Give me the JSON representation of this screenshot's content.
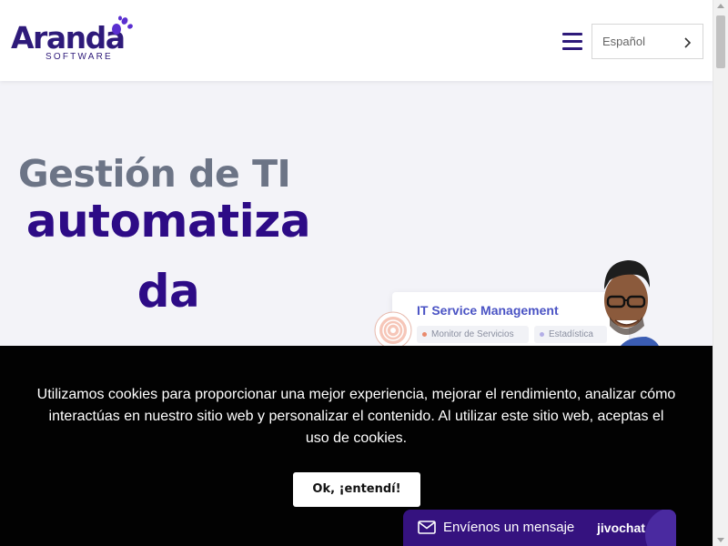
{
  "header": {
    "logo": {
      "name": "Aranda",
      "sub": "SOFTWARE"
    },
    "menu_icon": "hamburger-menu-icon",
    "language": {
      "label": "Español",
      "icon": "chevron-right-icon"
    }
  },
  "hero": {
    "title": "Gestión de TI",
    "accent_line1": "automatiza",
    "accent_line2": "da"
  },
  "itsm_card": {
    "title": "IT Service Management",
    "chips": [
      "Monitor de Servicios",
      "Estadística"
    ]
  },
  "cookie": {
    "text": "Utilizamos cookies para proporcionar una mejor experiencia, mejorar el rendimiento, analizar cómo interactúas en nuestro sitio web y personalizar el contenido. Al utilizar este sitio web, aceptas el uso de cookies.",
    "button": "Ok, ¡entendí!"
  },
  "chat": {
    "label": "Envíenos un mensaje",
    "brand": "jivochat",
    "icon": "envelope-icon"
  },
  "colors": {
    "brand": "#2e1a7a",
    "accent": "#2d0b86",
    "cookie_bg": "#020202",
    "chat_bg": "#35127f"
  }
}
